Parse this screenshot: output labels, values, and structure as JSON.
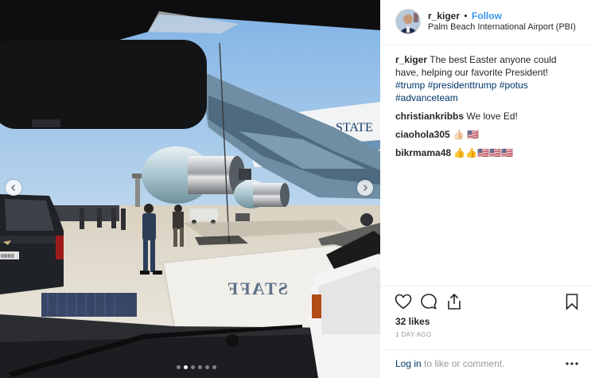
{
  "post": {
    "username": "r_kiger",
    "separator": "•",
    "follow_label": "Follow",
    "location": "Palm Beach International Airport (PBI)"
  },
  "caption": {
    "username": "r_kiger",
    "text": "The best Easter anyone could have, helping our favorite President!",
    "hashtags": [
      "#trump",
      "#presidenttrump",
      "#potus",
      "#advanceteam"
    ]
  },
  "comments": [
    {
      "username": "christiankribbs",
      "text": "We love Ed!"
    },
    {
      "username": "ciaohola305",
      "text": "👍🏻 🇺🇸"
    },
    {
      "username": "bikrmama48",
      "text": "👍👍🇺🇸🇺🇸🇺🇸"
    }
  ],
  "photo": {
    "plane_lettering": "STATE",
    "mat_text": "STAFF",
    "plate_text": "0000"
  },
  "stats": {
    "likes": "32 likes",
    "time": "1 DAY AGO"
  },
  "footer": {
    "login_link": "Log in",
    "login_rest": " to like or comment."
  },
  "icons": {
    "like": "heart-icon",
    "comment": "comment-bubble-icon",
    "share": "share-icon",
    "save": "bookmark-icon",
    "more": "more-options-icon"
  },
  "colors": {
    "link_blue": "#3897f0",
    "hashtag": "#003569",
    "muted": "#999999"
  },
  "carousel": {
    "slides": 6,
    "active_slide": 1
  }
}
